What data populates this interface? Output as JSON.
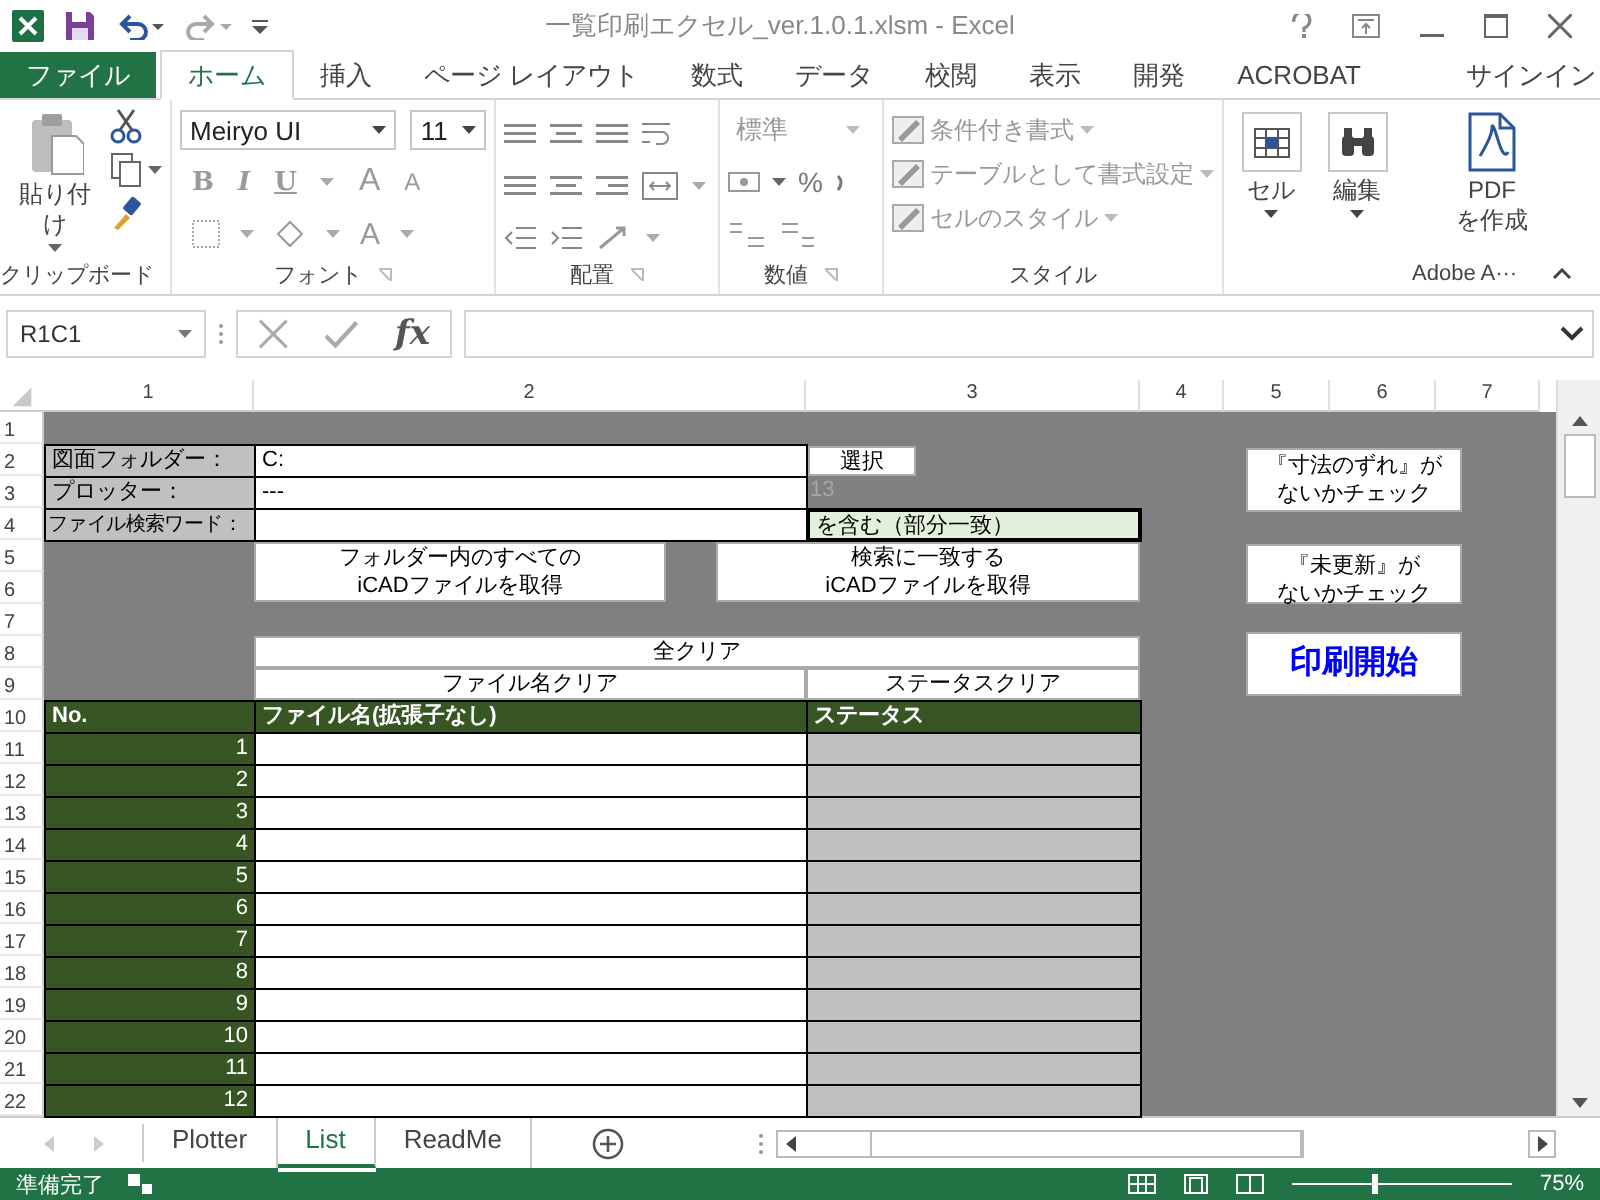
{
  "window": {
    "title": "一覧印刷エクセル_ver.1.0.1.xlsm - Excel"
  },
  "ribbon_tabs": [
    {
      "label": "ファイル",
      "kind": "file",
      "selected": false
    },
    {
      "label": "ホーム",
      "kind": "tab",
      "selected": true
    },
    {
      "label": "挿入",
      "kind": "tab",
      "selected": false
    },
    {
      "label": "ページ レイアウト",
      "kind": "tab",
      "selected": false
    },
    {
      "label": "数式",
      "kind": "tab",
      "selected": false
    },
    {
      "label": "データ",
      "kind": "tab",
      "selected": false
    },
    {
      "label": "校閲",
      "kind": "tab",
      "selected": false
    },
    {
      "label": "表示",
      "kind": "tab",
      "selected": false
    },
    {
      "label": "開発",
      "kind": "tab",
      "selected": false
    },
    {
      "label": "ACROBAT",
      "kind": "tab",
      "selected": false
    }
  ],
  "sign_in": "サインイン",
  "ribbon": {
    "paste": "貼り付け",
    "font_name": "Meiryo UI",
    "font_size": "11",
    "bold": "B",
    "italic": "I",
    "underline": "U",
    "grow_font": "A",
    "shrink_font": "A",
    "font_color": "A",
    "number_format": "標準",
    "percent": "%",
    "styles": [
      "条件付き書式",
      "テーブルとして書式設定",
      "セルのスタイル"
    ],
    "cells": "セル",
    "editing": "編集",
    "pdf": "PDF\nを作成",
    "groups": [
      "クリップボード",
      "フォント",
      "配置",
      "数値",
      "スタイル",
      "Adobe A···"
    ]
  },
  "formula_bar": {
    "name_box": "R1C1",
    "function_label": "fx"
  },
  "columns": [
    "1",
    "2",
    "3",
    "4",
    "5",
    "6",
    "7"
  ],
  "row_numbers": [
    "1",
    "2",
    "3",
    "4",
    "5",
    "6",
    "7",
    "8",
    "9",
    "10",
    "11",
    "12",
    "13",
    "14",
    "15",
    "16",
    "17",
    "18",
    "19",
    "20",
    "21",
    "22"
  ],
  "form": {
    "folder_label": "図面フォルダー：",
    "folder_value": "C:",
    "select_button": "選択",
    "plotter_label": "プロッター：",
    "plotter_value": "---",
    "plotter_count": "13",
    "search_label": "ファイル検索ワード：",
    "search_mode": "を含む（部分一致）",
    "get_all_button": "フォルダー内のすべての\niCADファイルを取得",
    "get_match_button": "検索に一致する\niCADファイルを取得",
    "clear_all_button": "全クリア",
    "clear_names_button": "ファイル名クリア",
    "clear_status_button": "ステータスクリア",
    "check_dimension_button": [
      "『寸法のずれ』が",
      "ないかチェック"
    ],
    "check_update_button": [
      "『未更新』が",
      "ないかチェック"
    ],
    "print_button": "印刷開始"
  },
  "list": {
    "columns": [
      "No.",
      "ファイル名(拡張子なし)",
      "ステータス"
    ],
    "rows": [
      {
        "no": "1"
      },
      {
        "no": "2"
      },
      {
        "no": "3"
      },
      {
        "no": "4"
      },
      {
        "no": "5"
      },
      {
        "no": "6"
      },
      {
        "no": "7"
      },
      {
        "no": "8"
      },
      {
        "no": "9"
      },
      {
        "no": "10"
      },
      {
        "no": "11"
      },
      {
        "no": "12"
      }
    ]
  },
  "sheet_tabs": [
    {
      "label": "Plotter",
      "selected": false
    },
    {
      "label": "List",
      "selected": true
    },
    {
      "label": "ReadMe",
      "selected": false
    }
  ],
  "status_bar": {
    "text": "準備完了",
    "zoom": "75%"
  }
}
